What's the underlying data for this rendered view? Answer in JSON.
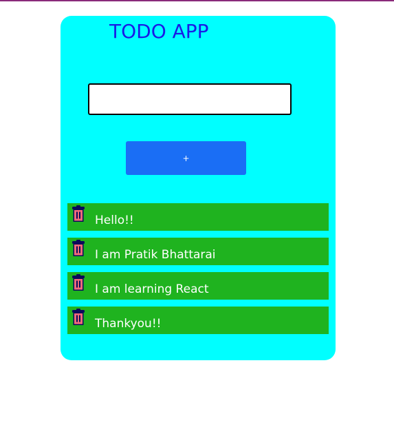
{
  "app": {
    "title": "TODO APP"
  },
  "input": {
    "value": "",
    "placeholder": ""
  },
  "add_button": {
    "label": "+"
  },
  "todos": [
    {
      "text": "Hello!!",
      "icon": "trash-icon"
    },
    {
      "text": "I am Pratik Bhattarai",
      "icon": "trash-icon"
    },
    {
      "text": "I am learning React",
      "icon": "trash-icon"
    },
    {
      "text": "Thankyou!!",
      "icon": "trash-icon"
    }
  ],
  "colors": {
    "card": "#00ffff",
    "title": "#1a1ae6",
    "button": "#1a6ef5",
    "item": "#1fb31f",
    "trash_lid": "#0a0a5a",
    "trash_body": "#f06a7a"
  }
}
